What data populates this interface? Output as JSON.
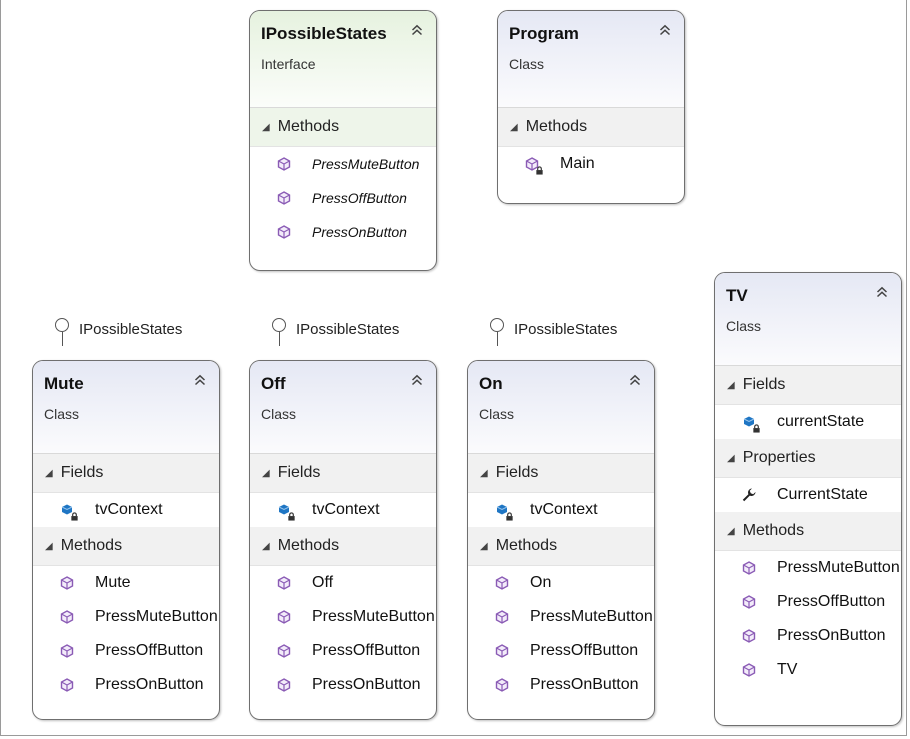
{
  "colors": {
    "header_class": "#e5e8f4",
    "header_interface": "#e6f2df",
    "border": "#6f6f6f",
    "method_icon": "#8a5bb5",
    "field_icon": "#1f76c4"
  },
  "boxes": {
    "ipossiblestates": {
      "title": "IPossibleStates",
      "kind": "Interface",
      "sections": [
        {
          "label": "Methods",
          "items": [
            "PressMuteButton",
            "PressOffButton",
            "PressOnButton"
          ]
        }
      ]
    },
    "program": {
      "title": "Program",
      "kind": "Class",
      "sections": [
        {
          "label": "Methods",
          "items": [
            "Main"
          ]
        }
      ]
    },
    "tv": {
      "title": "TV",
      "kind": "Class",
      "sections": [
        {
          "label": "Fields",
          "items": [
            "currentState"
          ]
        },
        {
          "label": "Properties",
          "items": [
            "CurrentState"
          ]
        },
        {
          "label": "Methods",
          "items": [
            "PressMuteButton",
            "PressOffButton",
            "PressOnButton",
            "TV"
          ]
        }
      ]
    },
    "mute": {
      "title": "Mute",
      "kind": "Class",
      "implements": "IPossibleStates",
      "sections": [
        {
          "label": "Fields",
          "items": [
            "tvContext"
          ]
        },
        {
          "label": "Methods",
          "items": [
            "Mute",
            "PressMuteButton",
            "PressOffButton",
            "PressOnButton"
          ]
        }
      ]
    },
    "off": {
      "title": "Off",
      "kind": "Class",
      "implements": "IPossibleStates",
      "sections": [
        {
          "label": "Fields",
          "items": [
            "tvContext"
          ]
        },
        {
          "label": "Methods",
          "items": [
            "Off",
            "PressMuteButton",
            "PressOffButton",
            "PressOnButton"
          ]
        }
      ]
    },
    "on": {
      "title": "On",
      "kind": "Class",
      "implements": "IPossibleStates",
      "sections": [
        {
          "label": "Fields",
          "items": [
            "tvContext"
          ]
        },
        {
          "label": "Methods",
          "items": [
            "On",
            "PressMuteButton",
            "PressOffButton",
            "PressOnButton"
          ]
        }
      ]
    }
  }
}
